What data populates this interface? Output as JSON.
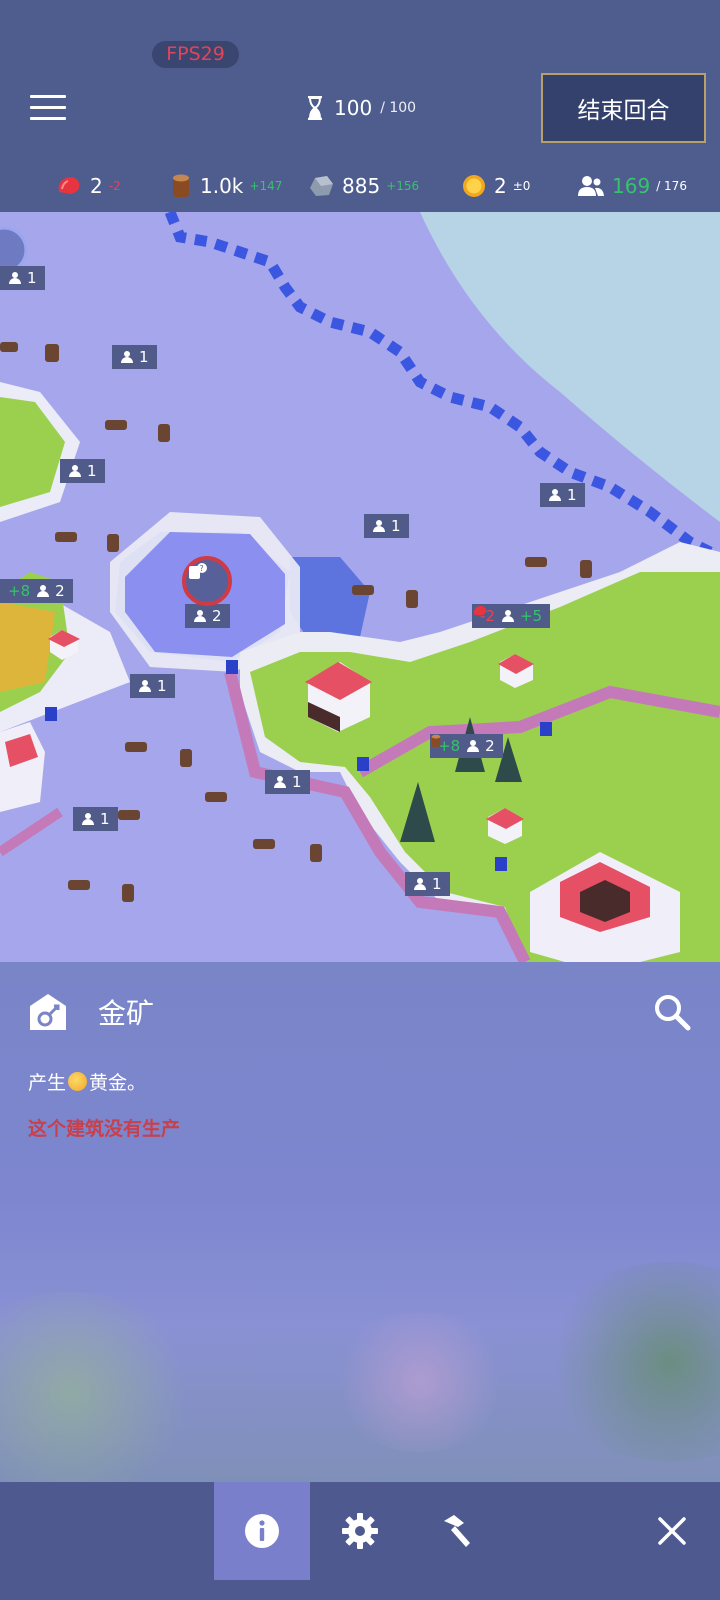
{
  "hud": {
    "fps": "FPS29",
    "turns": {
      "current": "100",
      "max": "/ 100"
    },
    "end_turn_label": "结束回合",
    "resources": [
      {
        "icon": "meat-icon",
        "amount": "2",
        "delta": "-2",
        "tone": "neg"
      },
      {
        "icon": "wood-log-icon",
        "amount": "1.0k",
        "delta": "+147",
        "tone": "pos"
      },
      {
        "icon": "stone-icon",
        "amount": "885",
        "delta": "+156",
        "tone": "pos"
      },
      {
        "icon": "gold-coin-icon",
        "amount": "2",
        "delta": "±0",
        "tone": "neu"
      },
      {
        "icon": "population-icon",
        "amount": "169",
        "delta": "/ 176",
        "tone": "pos"
      }
    ]
  },
  "map": {
    "labels": [
      {
        "text": "1"
      },
      {
        "text": "1"
      },
      {
        "text": "1"
      },
      {
        "text": "1"
      },
      {
        "text": "1"
      },
      {
        "text": "2"
      },
      {
        "text": "1"
      },
      {
        "text": "1"
      },
      {
        "text": "1"
      },
      {
        "text": "1"
      },
      {
        "text": "1"
      }
    ],
    "combo_left": {
      "prod": "+8",
      "pop": "2"
    },
    "combo_right": {
      "prod": "-2",
      "pop": "+5"
    },
    "combo_forest": {
      "prod": "+8",
      "pop": "2"
    }
  },
  "panel": {
    "building_icon": "gold-mine-icon",
    "title": "金矿",
    "desc_before": "产生",
    "desc_after": "黄金。",
    "warning": "这个建筑没有生产"
  },
  "bottombar": {
    "tabs": [
      {
        "icon": "info-icon",
        "active": true
      },
      {
        "icon": "gear-icon",
        "active": false
      },
      {
        "icon": "hammer-icon",
        "active": false
      },
      {
        "icon": "close-icon",
        "active": false
      }
    ]
  },
  "colors": {
    "accent_negative": "#e0455a",
    "accent_positive": "#34c46a",
    "hud_background": "#4f5d8e"
  }
}
